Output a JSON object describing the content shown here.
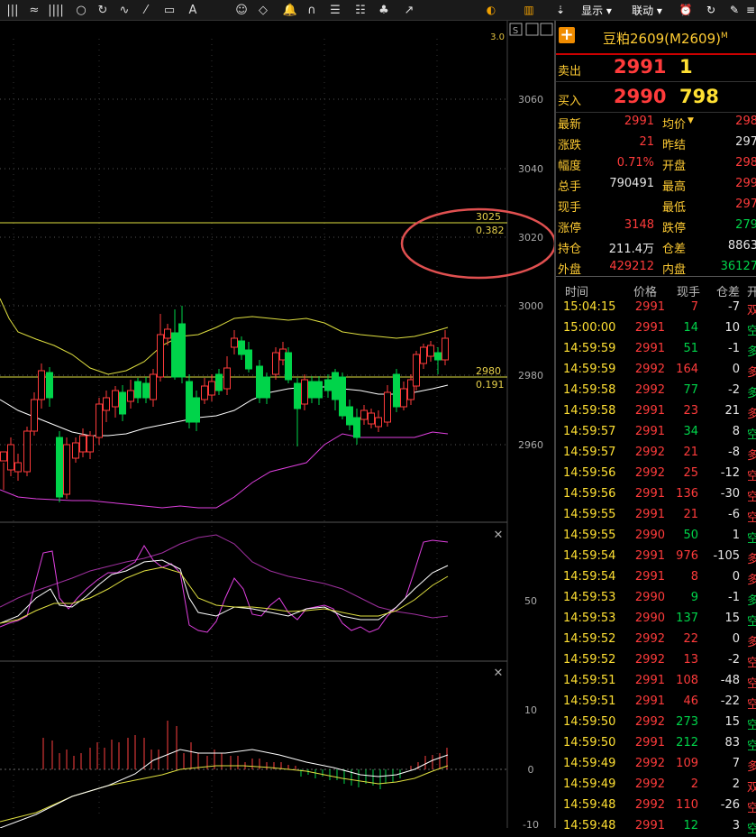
{
  "toolbar": {
    "items": [
      "|||",
      "≈",
      "||||",
      "○",
      "↻",
      "∿",
      "⁄",
      "▭",
      "A",
      "☺",
      "◇",
      "🔔",
      "∩",
      "☰",
      "☷",
      "♣",
      "↗"
    ],
    "display_label": "显示",
    "linkage_label": "联动",
    "right_icons": [
      "clock-icon",
      "refresh-icon",
      "edit-icon",
      "menu-icon"
    ]
  },
  "chart": {
    "s_label": "S",
    "top_cut_label": "3.0",
    "price_ticks": [
      "3060",
      "3040",
      "3020",
      "3000",
      "2980",
      "2960"
    ],
    "fib_lines": [
      {
        "price": "3025",
        "ratio": "0.382"
      },
      {
        "price": "2980",
        "ratio": "0.191"
      }
    ],
    "mid_tick": "50",
    "macd_ticks": [
      "10",
      "0",
      "-10"
    ],
    "colors": {
      "up": "#ff3b3b",
      "down": "#00d44a",
      "upper": "#e0e040",
      "mid": "#ffffff",
      "lower": "#e040e0",
      "fib": "#e0e040"
    }
  },
  "quote": {
    "title": "豆粕2609(M2609)",
    "title_sup": "M",
    "sell_label": "卖出",
    "sell_price": "2991",
    "sell_vol": "1",
    "buy_label": "买入",
    "buy_price": "2990",
    "buy_vol": "798",
    "rows": [
      {
        "l": "最新",
        "v": "2991",
        "vc": "red",
        "l2": "均价",
        "v2": "298",
        "v2c": "red"
      },
      {
        "l": "涨跌",
        "v": "21",
        "vc": "red",
        "l2": "昨结",
        "v2": "297",
        "v2c": "white"
      },
      {
        "l": "幅度",
        "v": "0.71%",
        "vc": "red",
        "l2": "开盘",
        "v2": "298",
        "v2c": "red"
      },
      {
        "l": "总手",
        "v": "790491",
        "vc": "white",
        "l2": "最高",
        "v2": "299",
        "v2c": "red"
      },
      {
        "l": "现手",
        "v": "",
        "vc": "white",
        "l2": "最低",
        "v2": "297",
        "v2c": "red"
      },
      {
        "l": "涨停",
        "v": "3148",
        "vc": "red",
        "l2": "跌停",
        "v2": "279",
        "v2c": "green"
      },
      {
        "l": "持仓",
        "v": "211.4万",
        "vc": "white",
        "l2": "仓差",
        "v2": "8863",
        "v2c": "white"
      },
      {
        "l": "外盘",
        "v": "429212",
        "vc": "red",
        "l2": "内盘",
        "v2": "36127",
        "v2c": "green"
      }
    ],
    "trade_headers": [
      "时间",
      "价格",
      "现手",
      "仓差",
      "开"
    ],
    "trades": [
      [
        "15:04:15",
        "2991",
        "7",
        "-7",
        "双",
        "red",
        "red",
        "red"
      ],
      [
        "15:00:00",
        "2991",
        "14",
        "10",
        "空",
        "red",
        "green",
        "green"
      ],
      [
        "14:59:59",
        "2991",
        "51",
        "-1",
        "多",
        "red",
        "green",
        "green"
      ],
      [
        "14:59:59",
        "2992",
        "164",
        "0",
        "多",
        "red",
        "red",
        "red"
      ],
      [
        "14:59:58",
        "2992",
        "77",
        "-2",
        "多",
        "red",
        "green",
        "green"
      ],
      [
        "14:59:58",
        "2991",
        "23",
        "21",
        "多",
        "red",
        "red",
        "red"
      ],
      [
        "14:59:57",
        "2991",
        "34",
        "8",
        "空",
        "red",
        "green",
        "green"
      ],
      [
        "14:59:57",
        "2992",
        "21",
        "-8",
        "多",
        "red",
        "red",
        "red"
      ],
      [
        "14:59:56",
        "2992",
        "25",
        "-12",
        "空",
        "red",
        "red",
        "red"
      ],
      [
        "14:59:56",
        "2991",
        "136",
        "-30",
        "空",
        "red",
        "red",
        "red"
      ],
      [
        "14:59:55",
        "2991",
        "21",
        "-6",
        "空",
        "red",
        "red",
        "red"
      ],
      [
        "14:59:55",
        "2990",
        "50",
        "1",
        "空",
        "red",
        "green",
        "green"
      ],
      [
        "14:59:54",
        "2991",
        "976",
        "-105",
        "多",
        "red",
        "red",
        "red"
      ],
      [
        "14:59:54",
        "2991",
        "8",
        "0",
        "多",
        "red",
        "red",
        "red"
      ],
      [
        "14:59:53",
        "2990",
        "9",
        "-1",
        "多",
        "red",
        "green",
        "green"
      ],
      [
        "14:59:53",
        "2990",
        "137",
        "15",
        "空",
        "red",
        "green",
        "green"
      ],
      [
        "14:59:52",
        "2992",
        "22",
        "0",
        "多",
        "red",
        "red",
        "red"
      ],
      [
        "14:59:52",
        "2992",
        "13",
        "-2",
        "空",
        "red",
        "red",
        "red"
      ],
      [
        "14:59:51",
        "2991",
        "108",
        "-48",
        "空",
        "red",
        "red",
        "red"
      ],
      [
        "14:59:51",
        "2991",
        "46",
        "-22",
        "空",
        "red",
        "red",
        "red"
      ],
      [
        "14:59:50",
        "2992",
        "273",
        "15",
        "空",
        "red",
        "green",
        "green"
      ],
      [
        "14:59:50",
        "2991",
        "212",
        "83",
        "空",
        "red",
        "green",
        "green"
      ],
      [
        "14:59:49",
        "2992",
        "109",
        "7",
        "多",
        "red",
        "red",
        "red"
      ],
      [
        "14:59:49",
        "2992",
        "2",
        "2",
        "双",
        "red",
        "red",
        "red"
      ],
      [
        "14:59:48",
        "2992",
        "110",
        "-26",
        "空",
        "red",
        "red",
        "red"
      ],
      [
        "14:59:48",
        "2991",
        "12",
        "3",
        "空",
        "red",
        "green",
        "green"
      ]
    ]
  }
}
